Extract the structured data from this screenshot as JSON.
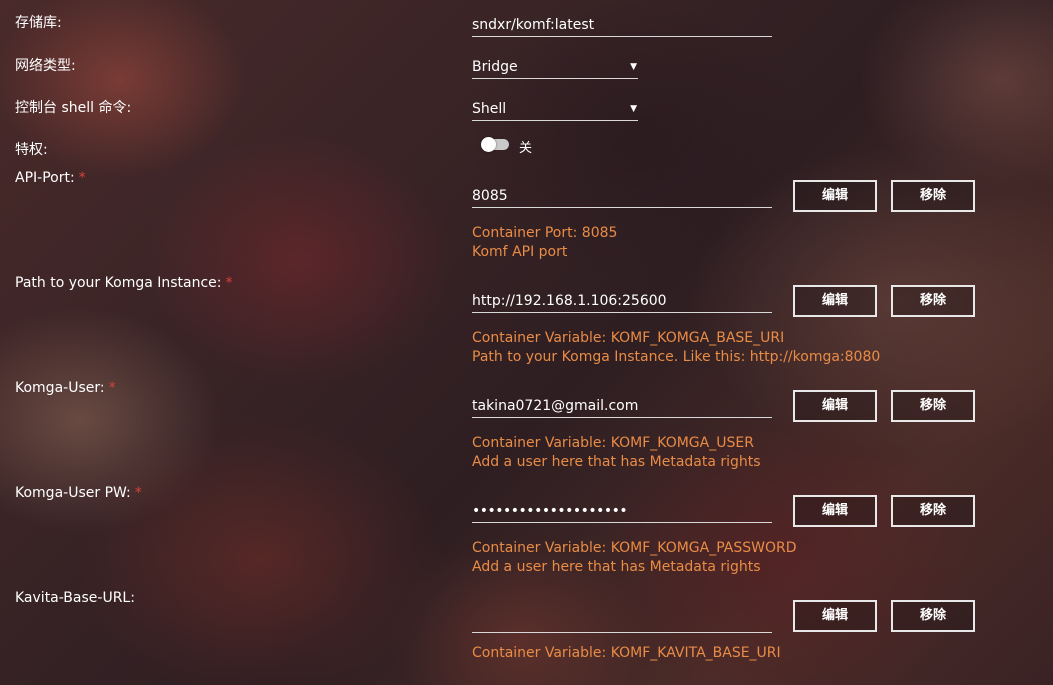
{
  "repository": {
    "label": "存储库:",
    "value": "sndxr/komf:latest"
  },
  "network_type": {
    "label": "网络类型:",
    "value": "Bridge"
  },
  "console_shell": {
    "label": "控制台 shell 命令:",
    "value": "Shell"
  },
  "privileged": {
    "label": "特权:",
    "toggle_label": "关",
    "enabled": false
  },
  "buttons": {
    "edit": "编辑",
    "remove": "移除"
  },
  "caret": "▼",
  "required_mark": "*",
  "colors": {
    "description": "#e98c46",
    "required": "#d9433a",
    "text": "#ffffff"
  },
  "fields": [
    {
      "label": "API-Port:",
      "required": true,
      "value": "8085",
      "desc_line1": "Container Port: 8085",
      "desc_line2": "Komf API port"
    },
    {
      "label": "Path to your Komga Instance:",
      "required": true,
      "value": "http://192.168.1.106:25600",
      "desc_line1": "Container Variable: KOMF_KOMGA_BASE_URI",
      "desc_line2": "Path to your Komga Instance. Like this: http://komga:8080"
    },
    {
      "label": "Komga-User:",
      "required": true,
      "value": "takina0721@gmail.com",
      "desc_line1": "Container Variable: KOMF_KOMGA_USER",
      "desc_line2": "Add a user here that has Metadata rights"
    },
    {
      "label": "Komga-User PW:",
      "required": true,
      "value": "••••••••••••••••••••",
      "desc_line1": "Container Variable: KOMF_KOMGA_PASSWORD",
      "desc_line2": "Add a user here that has Metadata rights"
    },
    {
      "label": "Kavita-Base-URL:",
      "required": false,
      "value": "",
      "desc_line1": "Container Variable: KOMF_KAVITA_BASE_URI"
    }
  ]
}
